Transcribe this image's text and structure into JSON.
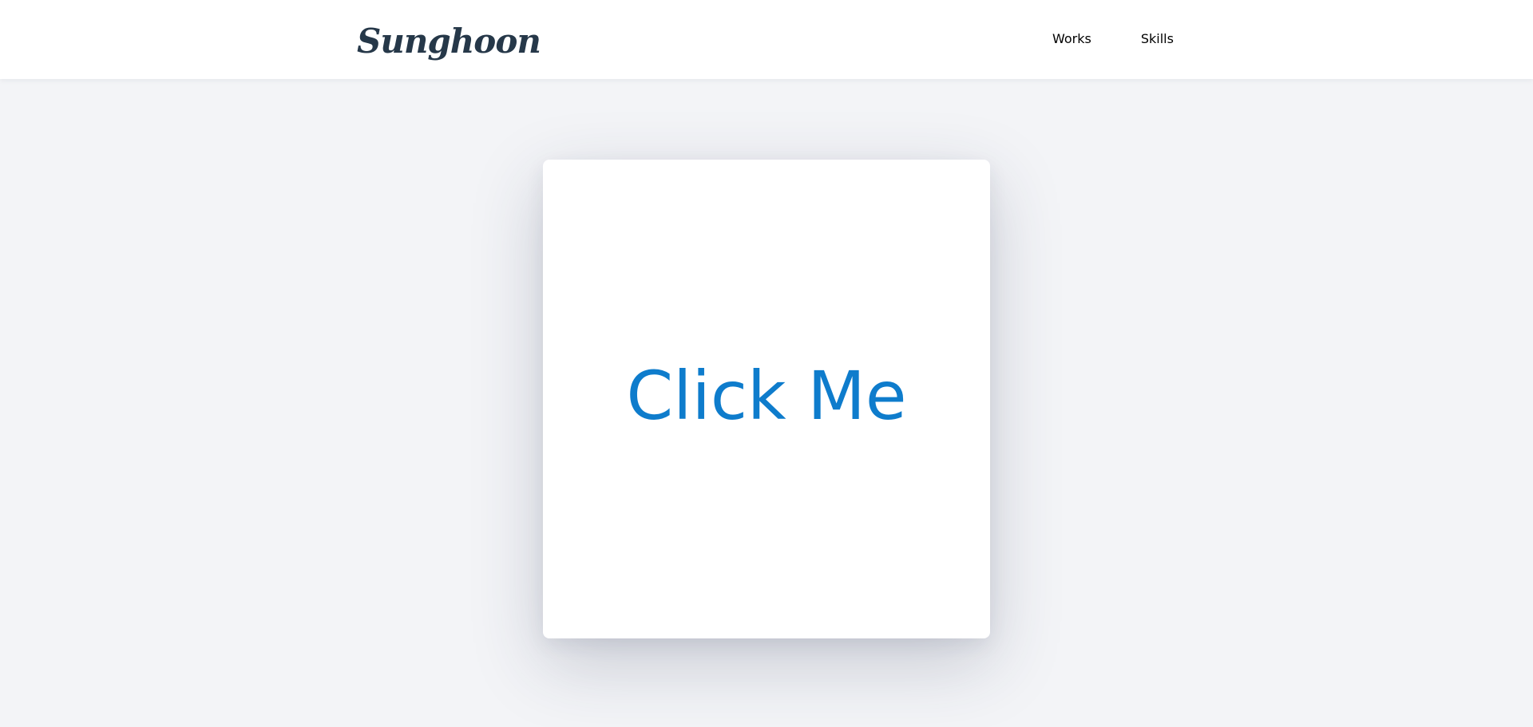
{
  "header": {
    "logo": "Sunghoon",
    "nav": [
      {
        "label": "Works"
      },
      {
        "label": "Skills"
      }
    ]
  },
  "card": {
    "label": "Click Me"
  },
  "colors": {
    "background": "#f3f4f7",
    "header_bg": "#ffffff",
    "logo": "#263849",
    "card_text": "#0e7ccc"
  }
}
